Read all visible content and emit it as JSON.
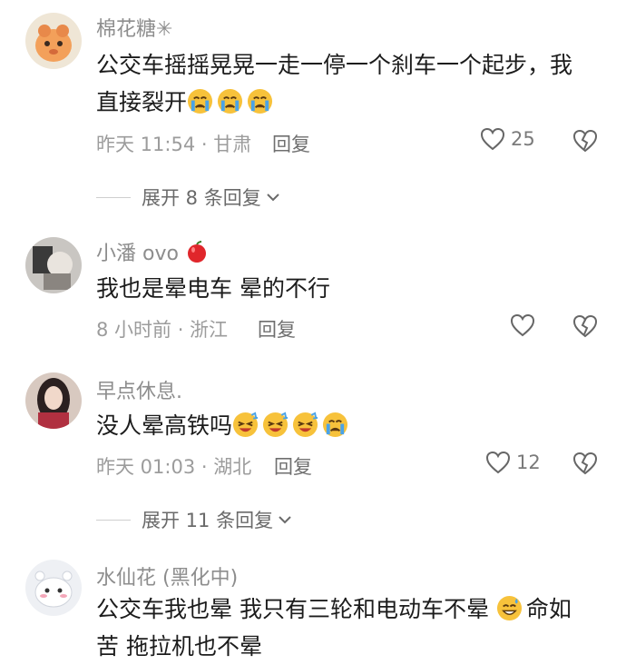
{
  "comments": [
    {
      "username": "棉花糖✳",
      "text": "公交车摇摇晃晃一走一停一个刹车一个起步，我直接裂开",
      "emojis": [
        "crying-face",
        "crying-face",
        "crying-face"
      ],
      "time_location": "昨天 11:54 · 甘肃",
      "reply_label": "回复",
      "like_count": "25"
    },
    {
      "username": "小潘 ovo",
      "text": "我也是晕电车 晕的不行",
      "time_location": "8 小时前 · 浙江",
      "reply_label": "回复",
      "like_count": ""
    },
    {
      "username": "早点休息.",
      "text": "没人晕高铁吗",
      "emojis": [
        "laughing-tears-face",
        "laughing-tears-face",
        "laughing-tears-face",
        "crying-face"
      ],
      "time_location": "昨天 01:03 · 湖北",
      "reply_label": "回复",
      "like_count": "12"
    },
    {
      "username": "水仙花 (黑化中)",
      "text_before_emoji": "公交车我也晕 我只有三轮和电动车不晕 ",
      "text_after_emoji": "命如苦 拖拉机也不晕",
      "emojis": [
        "grinning-sweat-face"
      ]
    }
  ],
  "expand_replies": [
    {
      "label": "展开 8 条回复"
    },
    {
      "label": "展开 11 条回复"
    }
  ],
  "colors": {
    "secondary_text": "#9c9c9c",
    "primary_text": "#1c1c1c",
    "emoji_yellow": "#f7c23b",
    "tear_blue": "#4aa3e8"
  }
}
